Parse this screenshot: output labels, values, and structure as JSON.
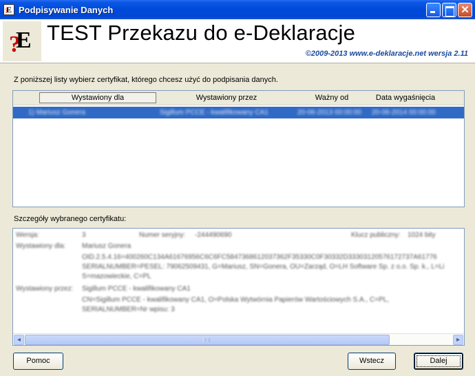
{
  "window": {
    "title": "Podpisywanie Danych",
    "icon_letter": "E",
    "close_glyph": "✕"
  },
  "header": {
    "logo_q": "?",
    "logo_e": "E",
    "title": "TEST Przekazu do e-Deklaracje",
    "subtitle": "©2009-2013 www.e-deklaracje.net wersja 2.11"
  },
  "main": {
    "instruction": "Z poniższej listy wybierz certyfikat, którego chcesz użyć do podpisania danych.",
    "list_columns": [
      "Wystawiony dla",
      "Wystawiony przez",
      "Ważny od",
      "Data wygaśnięcia"
    ],
    "selected_row": {
      "issued_to": "1) Mariusz Gonera",
      "issued_by": "Sigillum PCCE - kwalifikowany CA1",
      "valid_from": "20-06-2013 00:00:00",
      "valid_to": "20-06-2014 00:00:00"
    },
    "details_label": "Szczegóły wybranego certyfikatu:",
    "details": {
      "version_label": "Wersja:",
      "version_value": "3",
      "serial_label": "Numer seryjny:",
      "serial_value": "-244490690",
      "key_label": "Klucz publiczny:",
      "key_value": "1024 bity",
      "issued_to_label": "Wystawiony dla:",
      "issued_to_name": "Mariusz Gonera",
      "issued_to_line1": "OID.2.5.4.16=400260C134A61676956C6C6FC5847368612037362F35330C0F30332D33303120576172737A61776",
      "issued_to_line2": "SERIALNUMBER=PESEL: 79062509431, G=Mariusz, SN=Gonera, OU=Zarząd, O=LH Software Sp. z o.o. Sp. k., L=Li",
      "issued_to_line3": "S=mazowieckie, C=PL",
      "issued_by_label": "Wystawiony przez:",
      "issued_by_name": "Sigillum PCCE - kwalifikowany CA1",
      "issued_by_line1": "CN=Sigillum PCCE - kwalifikowany CA1, O=Polska Wytwórnia Papierów Wartościowych S.A., C=PL,",
      "issued_by_line2": "SERIALNUMBER=Nr wpisu: 3"
    }
  },
  "buttons": {
    "help": "Pomoc",
    "back": "Wstecz",
    "next": "Dalej"
  },
  "scrollbar": {
    "left_arrow": "◂",
    "right_arrow": "▸"
  }
}
